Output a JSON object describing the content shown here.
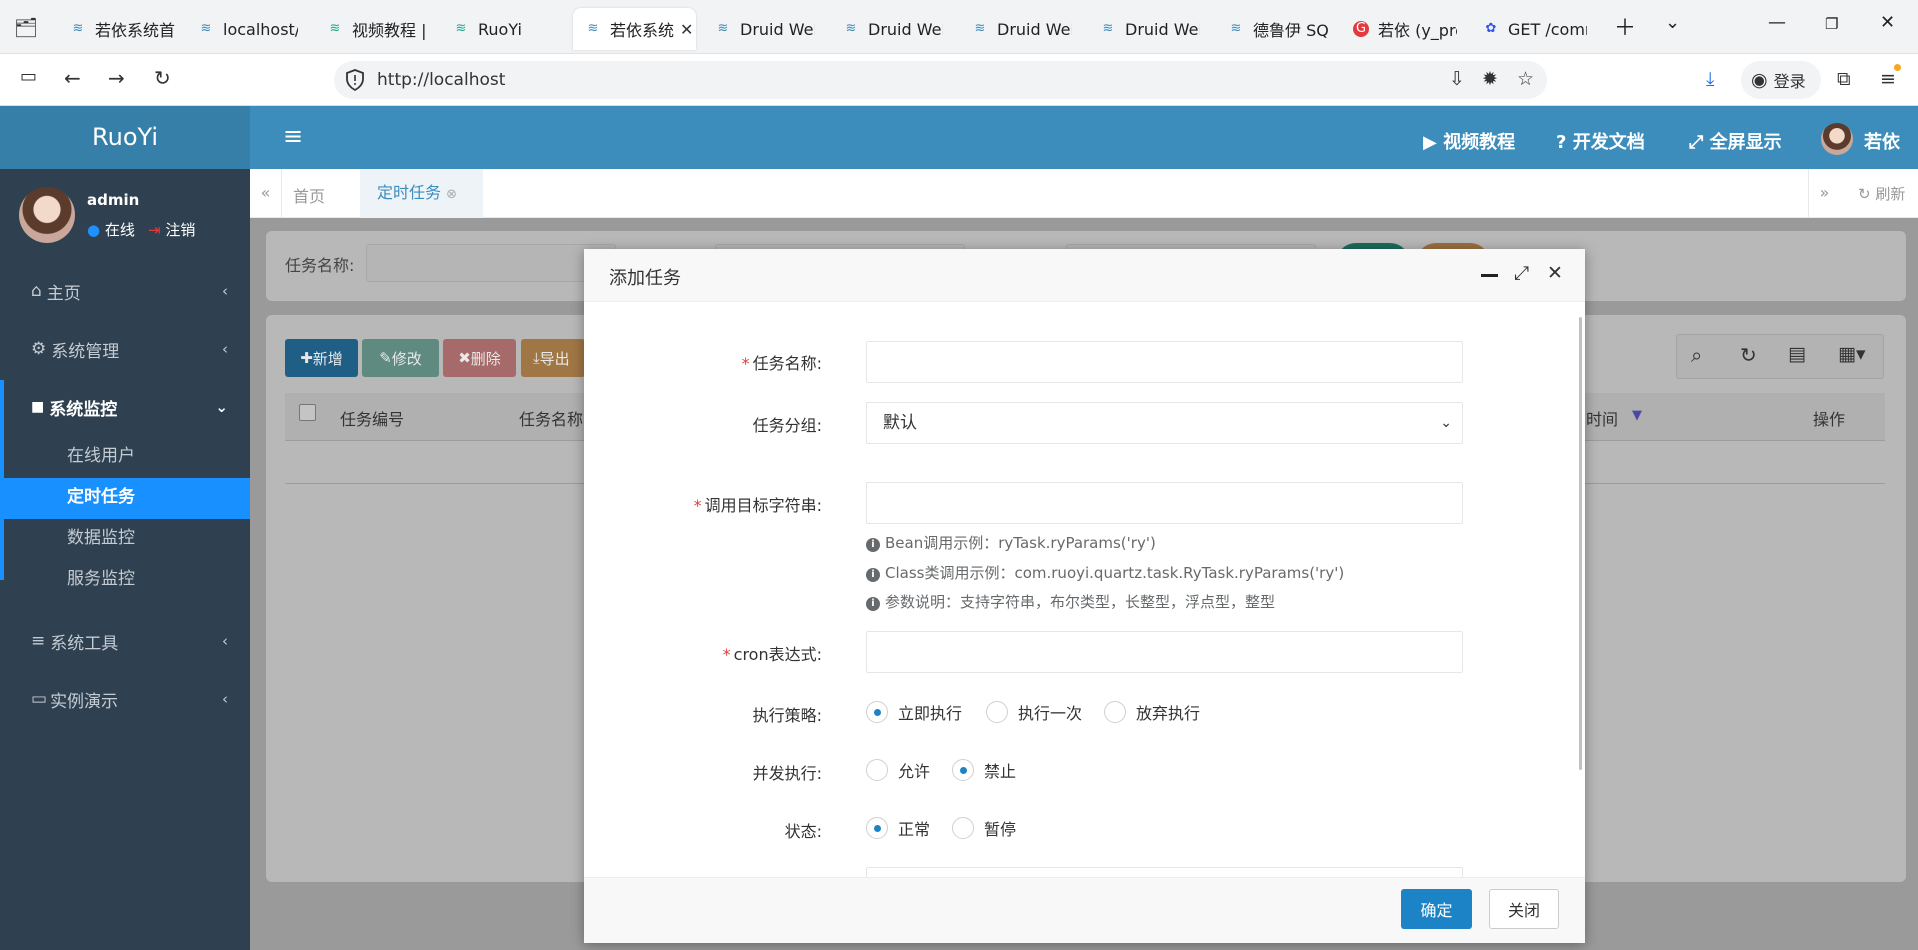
{
  "browser": {
    "tabs": [
      {
        "label": "若依系统首",
        "active": false
      },
      {
        "label": "localhost/\\",
        "active": false
      },
      {
        "label": "视频教程 | ",
        "active": false
      },
      {
        "label": "RuoYi",
        "active": false
      },
      {
        "label": "若依系统",
        "active": true
      },
      {
        "label": "Druid Web",
        "active": false
      },
      {
        "label": "Druid Web",
        "active": false
      },
      {
        "label": "Druid Web",
        "active": false
      },
      {
        "label": "Druid Web",
        "active": false
      },
      {
        "label": "德鲁伊 SQL",
        "active": false
      },
      {
        "label": "若依 (y_prc",
        "active": false
      },
      {
        "label": "GET /comr",
        "active": false
      }
    ],
    "url": "http://localhost",
    "login_label": "登录"
  },
  "app": {
    "logo": "RuoYi",
    "header_links": {
      "video": "视频教程",
      "docs": "开发文档",
      "fullscreen": "全屏显示",
      "user": "若依"
    },
    "user": {
      "name": "admin",
      "status": "在线",
      "logout": "注销"
    },
    "sidebar": {
      "home": "主页",
      "system": "系统管理",
      "monitor": "系统监控",
      "monitor_items": [
        "在线用户",
        "定时任务",
        "数据监控",
        "服务监控"
      ],
      "tools": "系统工具",
      "demo": "实例演示"
    },
    "page_tabs": {
      "home": "首页",
      "current": "定时任务",
      "refresh": "刷新"
    },
    "search": {
      "label": "任务名称:"
    },
    "toolbar": {
      "add": "新增",
      "edit": "修改",
      "delete": "删除",
      "export": "导出"
    },
    "table": {
      "col_id": "任务编号",
      "col_name": "任务名称",
      "col_time": "时间",
      "col_ops": "操作"
    }
  },
  "modal": {
    "title": "添加任务",
    "fields": {
      "name_label": "任务名称:",
      "group_label": "任务分组:",
      "group_value": "默认",
      "target_label": "调用目标字符串:",
      "hint1": "Bean调用示例：ryTask.ryParams('ry')",
      "hint2": "Class类调用示例：com.ruoyi.quartz.task.RyTask.ryParams('ry')",
      "hint3": "参数说明：支持字符串，布尔类型，长整型，浮点型，整型",
      "cron_label": "cron表达式:",
      "policy_label": "执行策略:",
      "policy_options": [
        "立即执行",
        "执行一次",
        "放弃执行"
      ],
      "concurrent_label": "并发执行:",
      "concurrent_options": [
        "允许",
        "禁止"
      ],
      "status_label": "状态:",
      "status_options": [
        "正常",
        "暂停"
      ]
    },
    "confirm": "确定",
    "close": "关闭"
  },
  "colors": {
    "header": "#3c8dbc",
    "logo": "#367fa9",
    "sidebar": "#2f4050",
    "active_menu": "#1890ff",
    "primary": "#1c84c6"
  }
}
